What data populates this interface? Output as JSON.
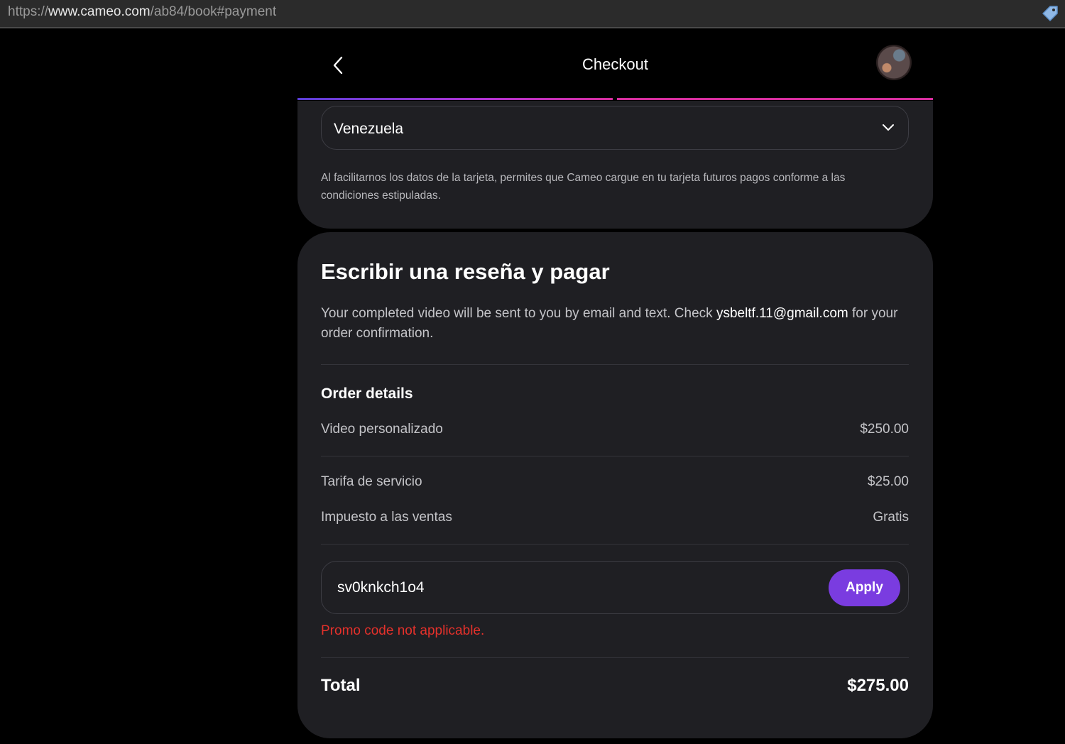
{
  "browser": {
    "url_prefix": "https://",
    "url_host": "www.cameo.com",
    "url_path": "/ab84/book#payment"
  },
  "header": {
    "title": "Checkout"
  },
  "billing": {
    "country_value": "Venezuela",
    "card_notice": "Al facilitarnos los datos de la tarjeta, permites que Cameo cargue en tu tarjeta futuros pagos conforme a las condiciones estipuladas."
  },
  "review": {
    "title": "Escribir una reseña y pagar",
    "info_before": "Your completed video will be sent to you by email and text. Check ",
    "email": "ysbeltf.11@gmail.com",
    "info_after": " for your order confirmation."
  },
  "order": {
    "title": "Order details",
    "items": [
      {
        "label": "Video personalizado",
        "value": "$250.00"
      },
      {
        "label": "Tarifa de servicio",
        "value": "$25.00"
      },
      {
        "label": "Impuesto a las ventas",
        "value": "Gratis"
      }
    ]
  },
  "promo": {
    "code_value": "sv0knkch1o4",
    "apply_label": "Apply",
    "error": "Promo code not applicable."
  },
  "total": {
    "label": "Total",
    "value": "$275.00"
  },
  "colors": {
    "accent": "#7a3ce0",
    "error": "#e5312b",
    "card_bg": "#1f1f23",
    "progress_pink": "#d62e9e"
  },
  "icons": {
    "back": "chevron-left-icon",
    "dropdown": "chevron-down-icon",
    "extension": "tag-icon"
  }
}
